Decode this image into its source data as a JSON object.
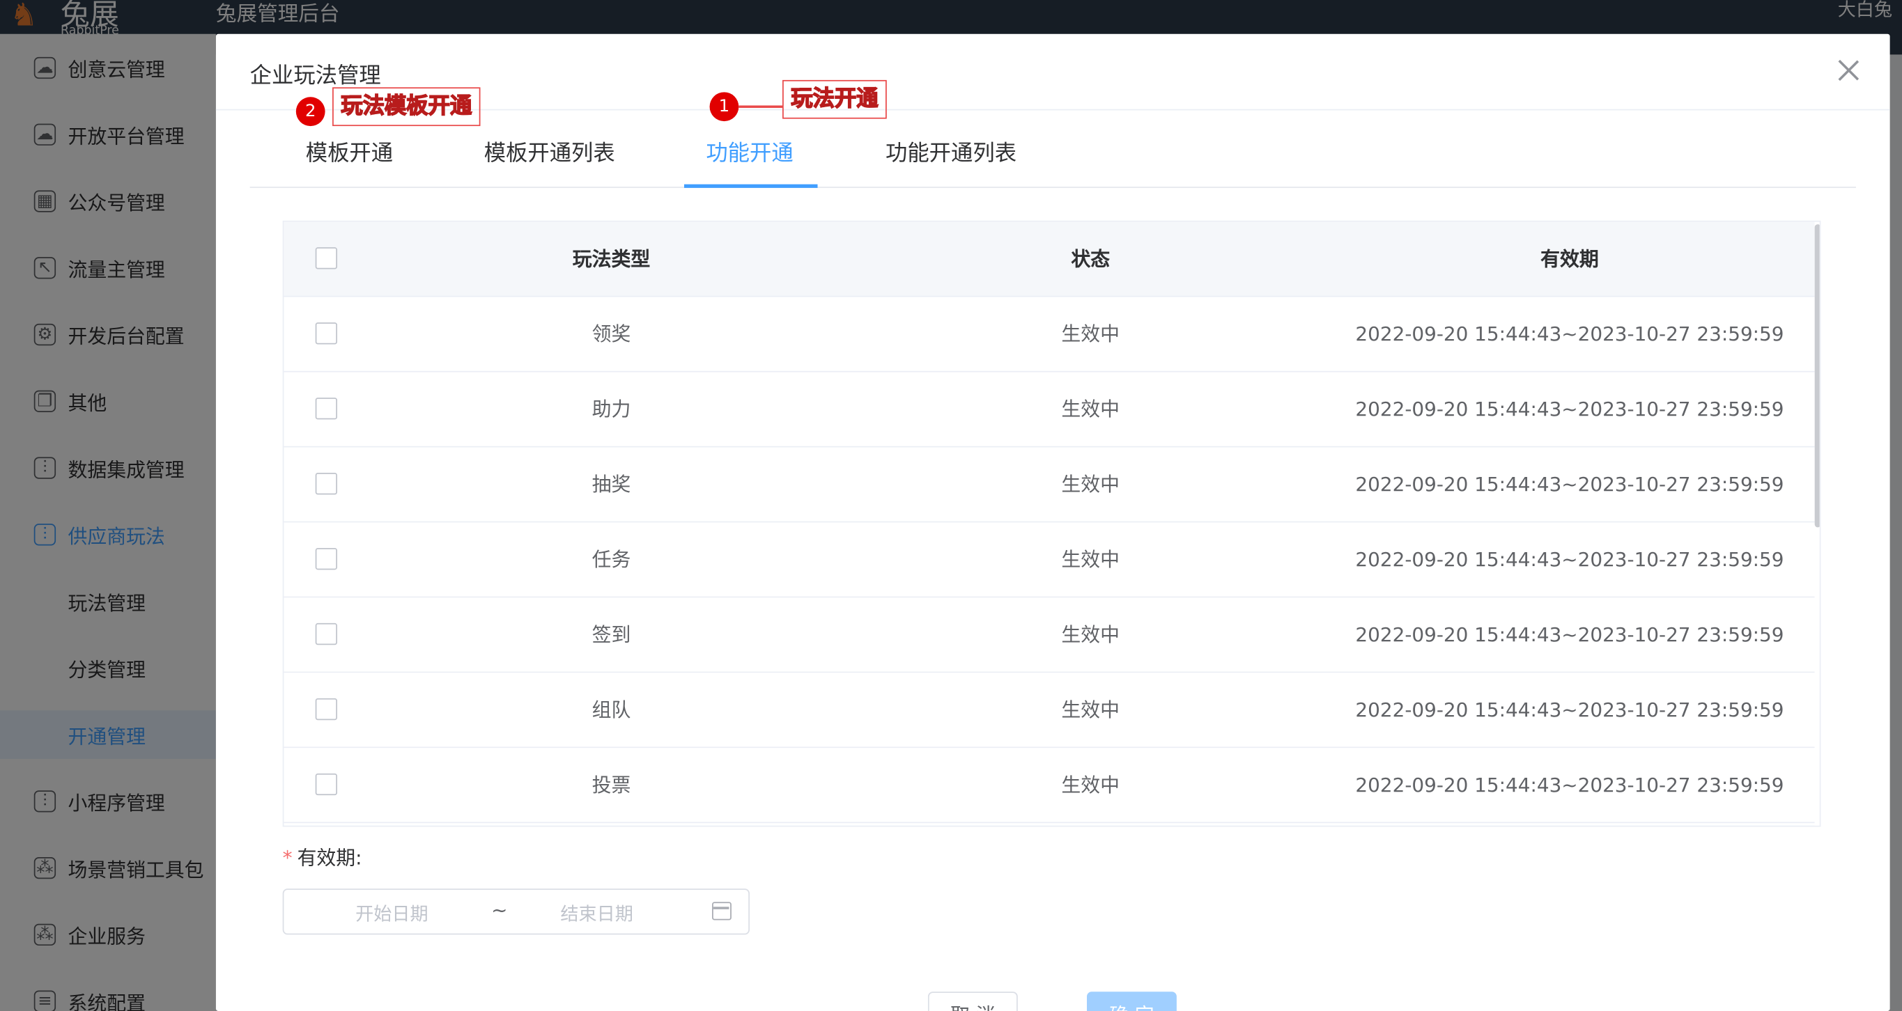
{
  "app": {
    "logo_cn": "兔展",
    "logo_en": "RabbitPre",
    "title": "兔展管理后台",
    "user": "大白兔"
  },
  "sidebar": {
    "items": [
      {
        "label": "创意云管理",
        "icon": "cloud-icon"
      },
      {
        "label": "开放平台管理",
        "icon": "cloud-icon"
      },
      {
        "label": "公众号管理",
        "icon": "calendar-icon"
      },
      {
        "label": "流量主管理",
        "icon": "cursor-icon"
      },
      {
        "label": "开发后台配置",
        "icon": "gear-icon"
      },
      {
        "label": "其他",
        "icon": "copy-icon"
      },
      {
        "label": "数据集成管理",
        "icon": "sliders-icon"
      },
      {
        "label": "供应商玩法",
        "icon": "sliders-icon"
      },
      {
        "label": "玩法管理"
      },
      {
        "label": "分类管理"
      },
      {
        "label": "开通管理"
      },
      {
        "label": "小程序管理",
        "icon": "sliders-icon"
      },
      {
        "label": "场景营销工具包",
        "icon": "nodes-icon"
      },
      {
        "label": "企业服务",
        "icon": "nodes-icon"
      },
      {
        "label": "系统配置",
        "icon": "stack-icon"
      }
    ]
  },
  "dialog": {
    "title": "企业玩法管理",
    "tabs": [
      "模板开通",
      "模板开通列表",
      "功能开通",
      "功能开通列表"
    ],
    "active_tab": "功能开通",
    "annotations": [
      {
        "number": "1",
        "text": "玩法开通"
      },
      {
        "number": "2",
        "text": "玩法模板开通"
      }
    ],
    "table": {
      "headers": [
        "玩法类型",
        "状态",
        "有效期"
      ],
      "rows": [
        {
          "type": "领奖",
          "status": "生效中",
          "period": "2022-09-20 15:44:43~2023-10-27 23:59:59"
        },
        {
          "type": "助力",
          "status": "生效中",
          "period": "2022-09-20 15:44:43~2023-10-27 23:59:59"
        },
        {
          "type": "抽奖",
          "status": "生效中",
          "period": "2022-09-20 15:44:43~2023-10-27 23:59:59"
        },
        {
          "type": "任务",
          "status": "生效中",
          "period": "2022-09-20 15:44:43~2023-10-27 23:59:59"
        },
        {
          "type": "签到",
          "status": "生效中",
          "period": "2022-09-20 15:44:43~2023-10-27 23:59:59"
        },
        {
          "type": "组队",
          "status": "生效中",
          "period": "2022-09-20 15:44:43~2023-10-27 23:59:59"
        },
        {
          "type": "投票",
          "status": "生效中",
          "period": "2022-09-20 15:44:43~2023-10-27 23:59:59"
        }
      ]
    },
    "validity": {
      "required_mark": "*",
      "label": "有效期:",
      "start_placeholder": "开始日期",
      "separator": "~",
      "end_placeholder": "结束日期"
    },
    "buttons": {
      "cancel": "取 消",
      "confirm": "确 定"
    }
  },
  "colors": {
    "accent": "#409eff",
    "annotation": "#e10000",
    "topbar": "#2d3a4b"
  }
}
